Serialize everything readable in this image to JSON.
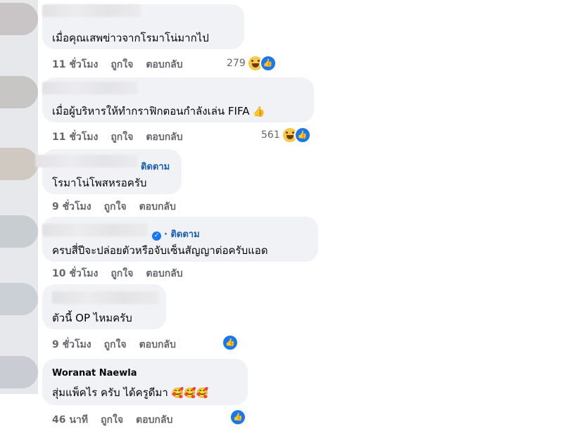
{
  "comments": [
    {
      "text": "เมื่อคุณเสพข่าวจากโรมาโน่มากไป",
      "meta": {
        "time": "11 ชั่วโมง",
        "like": "ถูกใจ",
        "reply": "ตอบกลับ"
      },
      "reactions": {
        "count": "279",
        "icons": [
          "haha-icon",
          "like-icon"
        ]
      }
    },
    {
      "text": "เมื่อผู้บริหารให้ทำกราฟิกตอนกำลังเล่น FIFA",
      "emoji": "👍",
      "meta": {
        "time": "11 ชั่วโมง",
        "like": "ถูกใจ",
        "reply": "ตอบกลับ"
      },
      "reactions": {
        "count": "561",
        "icons": [
          "haha-icon",
          "like-icon"
        ]
      }
    },
    {
      "follow": "ติดตาม",
      "text": "โรมาโน่โพสหรอครับ",
      "meta": {
        "time": "9 ชั่วโมง",
        "like": "ถูกใจ",
        "reply": "ตอบกลับ"
      }
    },
    {
      "follow": "· ติดตาม",
      "text": "ครบสี่ปีจะปล่อยตัวหรือจับเซ็นสัญญาต่อครับแอด",
      "meta": {
        "time": "10 ชั่วโมง",
        "like": "ถูกใจ",
        "reply": "ตอบกลับ"
      }
    },
    {
      "text": "ตัวนี้ OP ไหมครับ",
      "meta": {
        "time": "9 ชั่วโมง",
        "like": "ถูกใจ",
        "reply": "ตอบกลับ"
      },
      "reactions": {
        "count": "",
        "icons": [
          "like-icon"
        ]
      }
    },
    {
      "author": "Woranat Naewla",
      "text": "สุ่มแพ็คไร ครับ ได้ครูดีมา",
      "emoji": "🥰🥰🥰",
      "meta": {
        "time": "46 นาที",
        "like": "ถูกใจ",
        "reply": "ตอบกลับ"
      },
      "reactions": {
        "count": "",
        "icons": [
          "like-icon"
        ]
      }
    }
  ],
  "colors": {
    "bubble": "#f0f2f5",
    "meta": "#65676b",
    "follow": "#1a5fb4",
    "like": "#1877f2",
    "haha": "#f7c948"
  }
}
